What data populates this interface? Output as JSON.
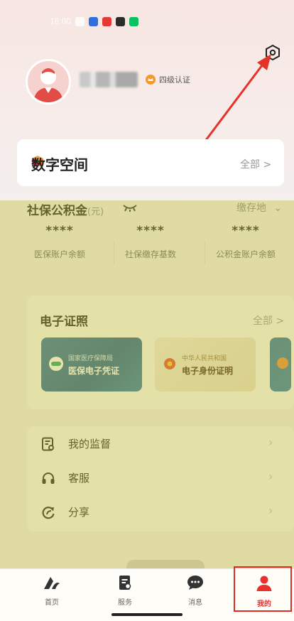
{
  "status_bar": {
    "time": "16:00"
  },
  "profile": {
    "level_badge": "四级认证"
  },
  "digital_space": {
    "title": "数字空间",
    "all_label": "全部 >"
  },
  "social": {
    "title": "社保公积金",
    "unit": "(元)",
    "location_label": "缴存地",
    "stats": [
      {
        "value": "****",
        "label": "医保账户余额"
      },
      {
        "value": "****",
        "label": "社保缴存基数"
      },
      {
        "value": "****",
        "label": "公积金账户余额"
      }
    ]
  },
  "e_certificates": {
    "title": "电子证照",
    "all_label": "全部 >",
    "cards": [
      {
        "org": "国家医疗保障局",
        "name": "医保电子凭证"
      },
      {
        "org": "中华人民共和国",
        "name": "电子身份证明"
      }
    ]
  },
  "menu": [
    {
      "label": "我的监督",
      "icon": "supervise-icon"
    },
    {
      "label": "客服",
      "icon": "headset-icon"
    },
    {
      "label": "分享",
      "icon": "share-icon"
    }
  ],
  "tabbar": [
    {
      "label": "首页",
      "icon": "home-logo-icon"
    },
    {
      "label": "服务",
      "icon": "service-icon"
    },
    {
      "label": "消息",
      "icon": "message-icon"
    },
    {
      "label": "我的",
      "icon": "profile-icon",
      "active": true
    }
  ],
  "colors": {
    "accent": "#e8302f",
    "highlight_box": "#e32a21",
    "overlay": "#c4be3c"
  }
}
